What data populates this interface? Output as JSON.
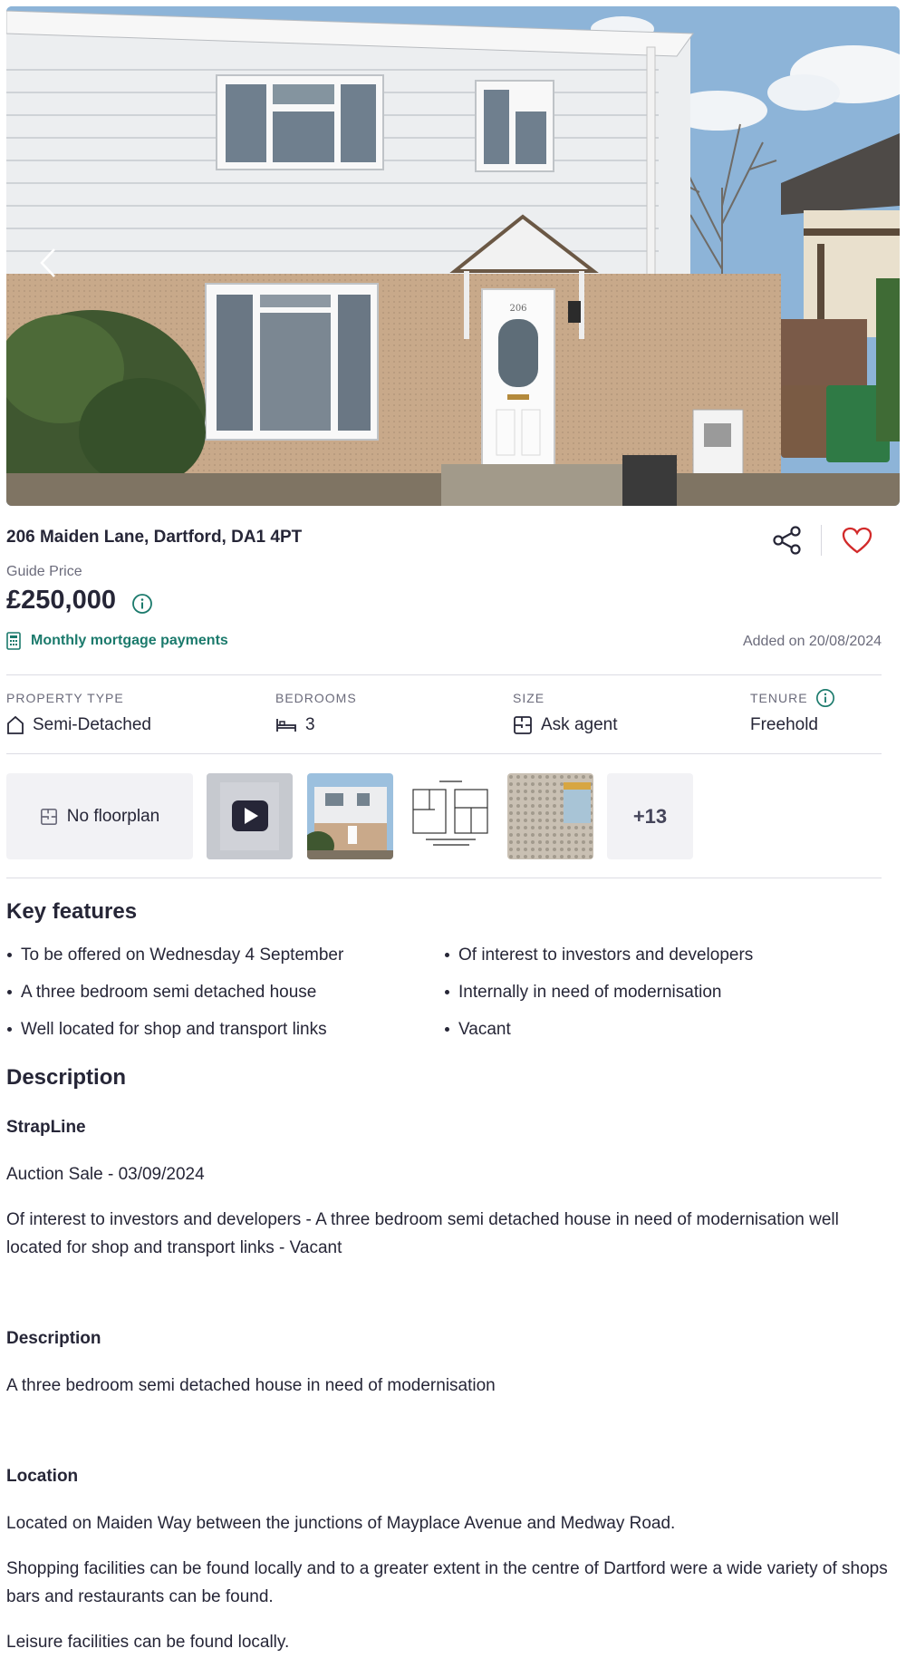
{
  "listing": {
    "address": "206 Maiden Lane, Dartford, DA1 4PT",
    "door_number": "206",
    "price_label": "Guide Price",
    "price": "£250,000",
    "mortgage_link": "Monthly mortgage payments",
    "added": "Added on 20/08/2024"
  },
  "facts": [
    {
      "label": "PROPERTY TYPE",
      "value": "Semi-Detached",
      "icon": "house-outline-icon"
    },
    {
      "label": "BEDROOMS",
      "value": "3",
      "icon": "bed-icon"
    },
    {
      "label": "SIZE",
      "value": "Ask agent",
      "icon": "floorplan-size-icon"
    },
    {
      "label": "TENURE",
      "value": "Freehold",
      "icon": "info-circle-icon"
    }
  ],
  "media": {
    "floorplan_label": "No floorplan",
    "more_count": "+13"
  },
  "key_features": {
    "heading": "Key features",
    "items": [
      "To be offered on Wednesday 4 September",
      "Of interest to investors and developers",
      "A three bedroom semi detached house",
      "Internally in need of modernisation",
      "Well located for shop and transport links",
      "Vacant"
    ]
  },
  "description": {
    "heading": "Description",
    "strapline_title": "StrapLine",
    "auction": "Auction Sale - 03/09/2024",
    "strapline_text": "Of interest to investors and developers - A three bedroom semi detached house in need of modernisation well located for shop and transport links - Vacant",
    "desc_title": "Description",
    "desc_text": "A three bedroom semi detached house in need of modernisation",
    "location_title": "Location",
    "location_p1": "Located on Maiden Way between the junctions of Mayplace Avenue and Medway Road.",
    "location_p2": "Shopping facilities can be found locally and to a greater extent in the centre of Dartford were a wide variety of shops bars and restaurants can be found.",
    "location_p3": "Leisure facilities can be found locally."
  },
  "colors": {
    "accent_green": "#1b7a6c",
    "favourite_red": "#d22a2a",
    "text": "#262637",
    "muted": "#6b6b7b"
  }
}
